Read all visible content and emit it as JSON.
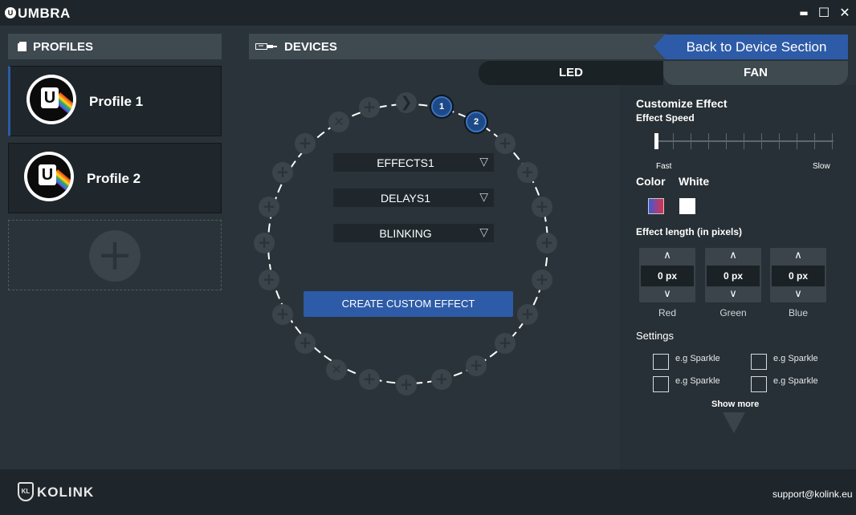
{
  "app": {
    "logo_letter": "U",
    "title": "UMBRA"
  },
  "window_controls": {
    "minimize": "▬",
    "maximize": "☐",
    "close": "✕"
  },
  "profiles": {
    "header": "PROFILES",
    "items": [
      {
        "name": "Profile 1",
        "active": true
      },
      {
        "name": "Profile 2",
        "active": false
      }
    ],
    "add_icon": "+"
  },
  "devices": {
    "header": "DEVICES",
    "back_button": "Back to Device Section"
  },
  "tabs": [
    {
      "label": "LED",
      "active": true
    },
    {
      "label": "FAN",
      "active": false
    }
  ],
  "ring": {
    "selected_1": "1",
    "selected_2": "2",
    "dropdowns": [
      "EFFECTS1",
      "DELAYS1",
      "BLINKING"
    ],
    "dropdown_arrow": "▽",
    "create_button": "CREATE CUSTOM EFFECT"
  },
  "customize": {
    "title": "Customize Effect",
    "speed_label": "Effect Speed",
    "speed_value": 0,
    "fast_label": "Fast",
    "slow_label": "Slow",
    "color_label": "Color",
    "white_label": "White",
    "length_label": "Effect length (in pixels)",
    "steppers": [
      {
        "value": "0 px",
        "caption": "Red"
      },
      {
        "value": "0 px",
        "caption": "Green"
      },
      {
        "value": "0 px",
        "caption": "Blue"
      }
    ],
    "settings_label": "Settings",
    "settings_options": [
      "e.g Sparkle",
      "e.g Sparkle",
      "e.g Sparkle",
      "e.g Sparkle"
    ],
    "show_more": "Show more"
  },
  "footer": {
    "brand": "KOLINK",
    "badge": "KL",
    "support_email": "support@kolink.eu"
  },
  "colors": {
    "accent": "#2d5ba7",
    "background": "#2a3339",
    "panel": "#3e4950"
  }
}
